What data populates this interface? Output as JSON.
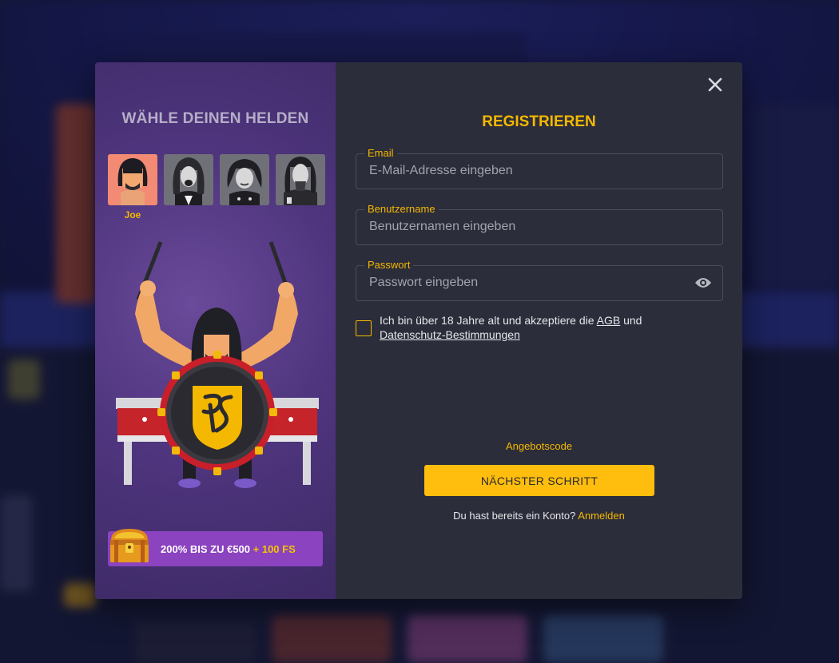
{
  "hero_panel": {
    "title": "WÄHLE DEINEN HELDEN",
    "heroes": [
      {
        "name": "Joe",
        "selected": true,
        "icon": "hero-avatar-icon"
      },
      {
        "name": "",
        "selected": false,
        "icon": "hero-avatar-icon"
      },
      {
        "name": "",
        "selected": false,
        "icon": "hero-avatar-icon"
      },
      {
        "name": "",
        "selected": false,
        "icon": "hero-avatar-icon"
      }
    ],
    "selected_name": "Joe",
    "promo": {
      "text": "200% BIS ZU €500",
      "extra": "+ 100 FS",
      "icon": "treasure-chest-icon"
    }
  },
  "form": {
    "title": "REGISTRIEREN",
    "email": {
      "label": "Email",
      "placeholder": "E-Mail-Adresse eingeben",
      "value": ""
    },
    "username": {
      "label": "Benutzername",
      "placeholder": "Benutzernamen eingeben",
      "value": ""
    },
    "password": {
      "label": "Passwort",
      "placeholder": "Passwort eingeben",
      "value": ""
    },
    "terms": {
      "prefix": "Ich bin über 18 Jahre alt und akzeptiere die",
      "agb": "AGB",
      "und": "und",
      "privacy": "Datenschutz-Bestimmungen",
      "checked": false
    },
    "promo_code_link": "Angebotscode",
    "next_button": "NÄCHSTER SCHRITT",
    "login_prompt": "Du hast bereits ein Konto?",
    "login_link": "Anmelden"
  },
  "colors": {
    "accent": "#f5b800",
    "panel_bg": "#2b2d3a",
    "hero_bg": "#4f357e",
    "promo_bg": "#8b43c0"
  }
}
